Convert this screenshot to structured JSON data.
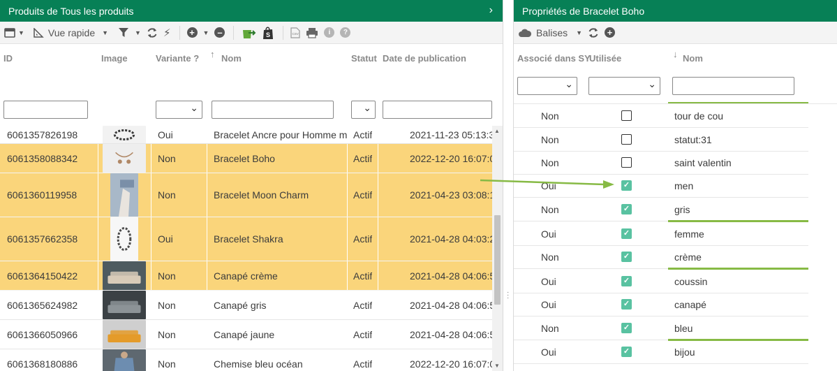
{
  "left": {
    "title": "Produits de Tous les produits",
    "toolbar": {
      "view_label": "Vue rapide"
    },
    "columns": {
      "id": "ID",
      "image": "Image",
      "variante": "Variante ?",
      "nom": "Nom",
      "statut": "Statut",
      "date": "Date de publication"
    },
    "rows": [
      {
        "id": "6061357826198",
        "variante": "Oui",
        "nom": "Bracelet Ancre pour Homme m",
        "statut": "Actif",
        "date": "2021-11-23 05:13:3",
        "selected": false,
        "thumb": "bracelet-ancre"
      },
      {
        "id": "6061358088342",
        "variante": "Non",
        "nom": "Bracelet Boho",
        "statut": "Actif",
        "date": "2022-12-20 16:07:0",
        "selected": true,
        "thumb": "bracelet-boho"
      },
      {
        "id": "6061360119958",
        "variante": "Non",
        "nom": "Bracelet Moon Charm",
        "statut": "Actif",
        "date": "2021-04-23 03:08:1",
        "selected": true,
        "thumb": "bracelet-moon"
      },
      {
        "id": "6061357662358",
        "variante": "Oui",
        "nom": "Bracelet Shakra",
        "statut": "Actif",
        "date": "2021-04-28 04:03:2",
        "selected": true,
        "thumb": "bracelet-shakra"
      },
      {
        "id": "6061364150422",
        "variante": "Non",
        "nom": "Canapé crème",
        "statut": "Actif",
        "date": "2021-04-28 04:06:5",
        "selected": true,
        "thumb": "canape-creme"
      },
      {
        "id": "6061365624982",
        "variante": "Non",
        "nom": "Canapé gris",
        "statut": "Actif",
        "date": "2021-04-28 04:06:5",
        "selected": false,
        "thumb": "canape-gris"
      },
      {
        "id": "6061366050966",
        "variante": "Non",
        "nom": "Canapé jaune",
        "statut": "Actif",
        "date": "2021-04-28 04:06:5",
        "selected": false,
        "thumb": "canape-jaune"
      },
      {
        "id": "6061368180886",
        "variante": "Non",
        "nom": "Chemise bleu océan",
        "statut": "Actif",
        "date": "2022-12-20 16:07:0",
        "selected": false,
        "thumb": "chemise"
      }
    ]
  },
  "right": {
    "title": "Propriétés de Bracelet Boho",
    "toolbar": {
      "tags_label": "Balises"
    },
    "columns": {
      "associe": "Associé dans SY",
      "utilisee": "Utilisée",
      "nom": "Nom"
    },
    "rows": [
      {
        "associe": "Non",
        "utilisee": false,
        "nom": "tour de cou",
        "underline": false
      },
      {
        "associe": "Non",
        "utilisee": false,
        "nom": "statut:31",
        "underline": false
      },
      {
        "associe": "Non",
        "utilisee": false,
        "nom": "saint valentin",
        "underline": false
      },
      {
        "associe": "Oui",
        "utilisee": true,
        "nom": "men",
        "underline": false
      },
      {
        "associe": "Non",
        "utilisee": true,
        "nom": "gris",
        "underline": true
      },
      {
        "associe": "Oui",
        "utilisee": true,
        "nom": "femme",
        "underline": false
      },
      {
        "associe": "Non",
        "utilisee": true,
        "nom": "crème",
        "underline": true
      },
      {
        "associe": "Oui",
        "utilisee": true,
        "nom": "coussin",
        "underline": false
      },
      {
        "associe": "Oui",
        "utilisee": true,
        "nom": "canapé",
        "underline": false
      },
      {
        "associe": "Non",
        "utilisee": true,
        "nom": "bleu",
        "underline": true
      },
      {
        "associe": "Oui",
        "utilisee": true,
        "nom": "bijou",
        "underline": false
      }
    ]
  },
  "colors": {
    "header_green": "#078056",
    "selected_row": "#fad57b",
    "checkbox_on": "#59c2a1",
    "arrow_green": "#87ba45"
  }
}
